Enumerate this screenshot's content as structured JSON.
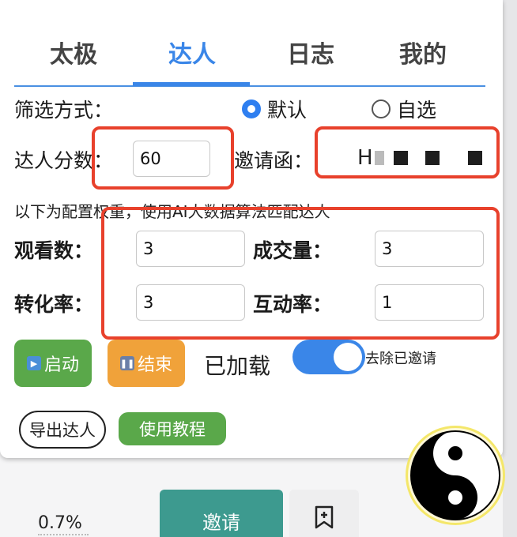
{
  "tabs": [
    {
      "label": "太极"
    },
    {
      "label": "达人"
    },
    {
      "label": "日志"
    },
    {
      "label": "我的"
    }
  ],
  "filter": {
    "label": "筛选方式：",
    "option_default": "默认",
    "option_custom": "自选",
    "selected": "默认"
  },
  "score": {
    "label": "达人分数：",
    "value": "60"
  },
  "invite": {
    "label": "邀请函：",
    "value": "H"
  },
  "info": "以下为配置权重，使用AI大数据算法匹配达人",
  "weights": {
    "views": {
      "label": "观看数：",
      "value": "3"
    },
    "deals": {
      "label": "成交量：",
      "value": "3"
    },
    "conversion": {
      "label": "转化率：",
      "value": "3"
    },
    "interaction": {
      "label": "互动率：",
      "value": "1"
    }
  },
  "controls": {
    "start": "启动",
    "stop": "结束",
    "loaded": "已加载",
    "toggle_label": "去除已邀请",
    "toggle_on": true,
    "export": "导出达人",
    "tutorial": "使用教程"
  },
  "background": {
    "percent": "0.7%",
    "invite_button": "邀请"
  },
  "colors": {
    "accent": "#3a86e8",
    "highlight": "#e8412c",
    "start": "#5aa84a",
    "stop": "#f0a23a"
  }
}
